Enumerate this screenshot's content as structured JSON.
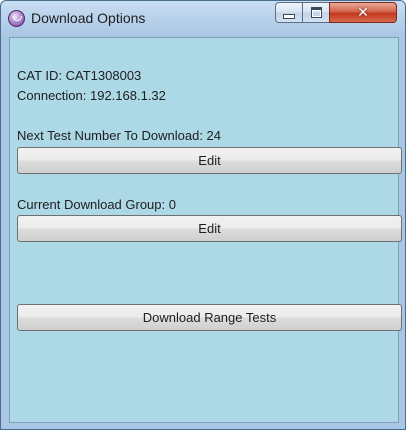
{
  "window": {
    "title": "Download Options",
    "controls": {
      "minimize": "",
      "maximize": "",
      "close": "✕"
    }
  },
  "info": {
    "cat_id": "CAT ID: CAT1308003",
    "connection": "Connection: 192.168.1.32"
  },
  "next_test": {
    "label": "Next Test Number To Download: 24",
    "button": "Edit"
  },
  "download_group": {
    "label": "Current Download Group: 0",
    "button": "Edit"
  },
  "range": {
    "button": "Download Range Tests"
  },
  "colors": {
    "client_background": "#add8e6",
    "close_button": "#c2381e"
  }
}
